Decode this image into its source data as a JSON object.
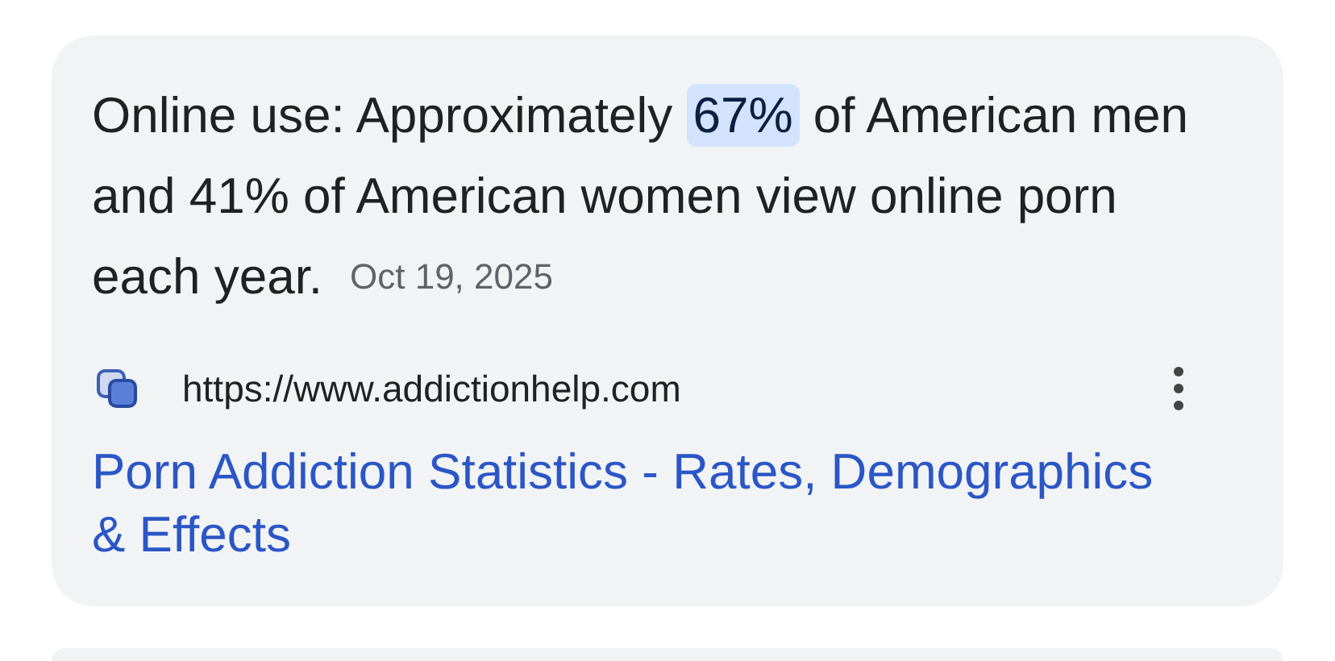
{
  "result": {
    "snippet": "Online use: Approximately **67%** of American men and 41% of American women view online porn each year.",
    "date": "Oct 19, 2025",
    "url": "https://www.addictionhelp.com",
    "title": "Porn Addiction Statistics - Rates, Demographics & Effects"
  }
}
